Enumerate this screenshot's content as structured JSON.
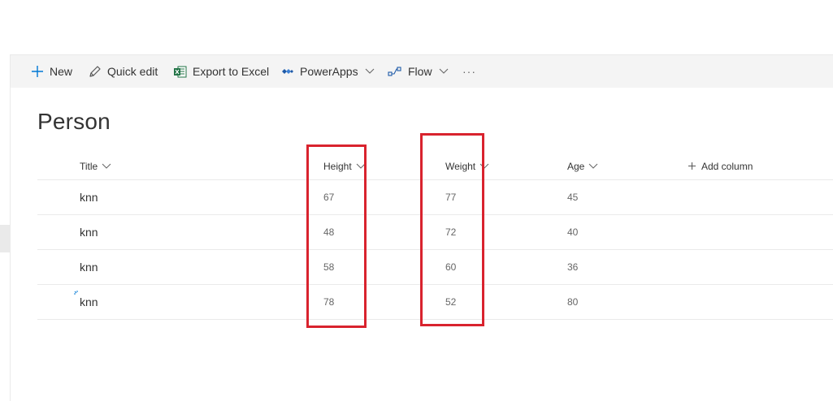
{
  "toolbar": {
    "new_label": "New",
    "quick_edit_label": "Quick edit",
    "export_label": "Export to Excel",
    "powerapps_label": "PowerApps",
    "flow_label": "Flow",
    "more_label": "···"
  },
  "list": {
    "title": "Person",
    "columns": {
      "title": "Title",
      "height": "Height",
      "weight": "Weight",
      "age": "Age",
      "add": "Add column"
    },
    "rows": [
      {
        "title": "knn",
        "height": "67",
        "weight": "77",
        "age": "45"
      },
      {
        "title": "knn",
        "height": "48",
        "weight": "72",
        "age": "40"
      },
      {
        "title": "knn",
        "height": "58",
        "weight": "60",
        "age": "36"
      },
      {
        "title": "knn",
        "height": "78",
        "weight": "52",
        "age": "80"
      }
    ]
  },
  "colors": {
    "highlight": "#d9232e",
    "accent": "#0078d4",
    "excel_green": "#217346"
  }
}
